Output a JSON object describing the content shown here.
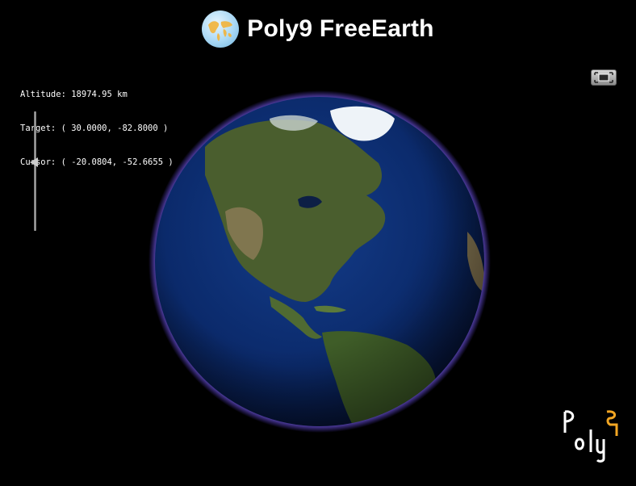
{
  "header": {
    "title": "Poly9 FreeEarth",
    "logo_icon": "world-map-icon"
  },
  "info": {
    "altitude_label": "Altitude:",
    "altitude_value": "18974.95 km",
    "target_label": "Target:",
    "target_value": "( 30.0000, -82.8000 )",
    "cursor_label": "Cursor:",
    "cursor_value": "( -20.0804, -52.6655 )"
  },
  "controls": {
    "zoom_slider_icon": "zoom-slider",
    "zoom_level": 0.42,
    "fullscreen_icon": "fullscreen-icon"
  },
  "globe": {
    "atmosphere_color": "#7a5cff",
    "ocean_color": "#0b2a6b",
    "land_color": "#3d5a2a"
  },
  "brand": {
    "logo_text": "poly9"
  }
}
